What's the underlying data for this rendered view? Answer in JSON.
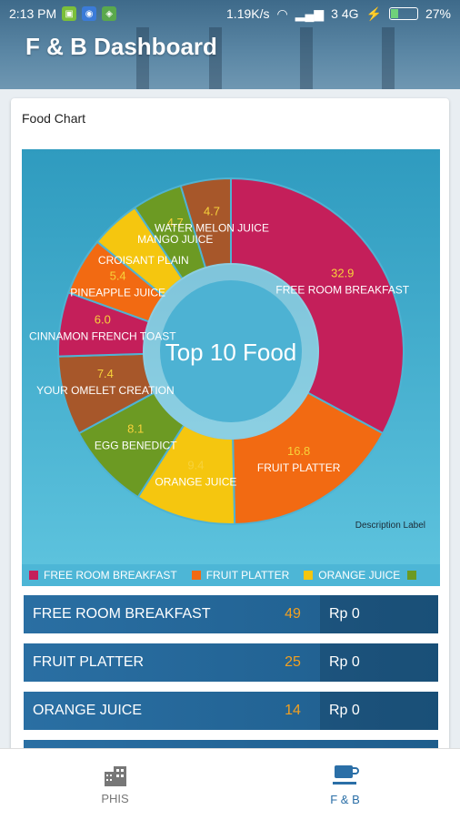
{
  "status": {
    "time": "2:13 PM",
    "speed": "1.19K/s",
    "network": "3 4G",
    "battery": "27%"
  },
  "header": {
    "title": "F & B Dashboard"
  },
  "card": {
    "title": "Food Chart"
  },
  "chart_data": {
    "type": "pie",
    "center_text": "Top 10 Food",
    "description": "Description Label",
    "labels": [
      "FREE ROOM BREAKFAST",
      "FRUIT PLATTER",
      "ORANGE JUICE",
      "EGG BENEDICT",
      "YOUR OMELET CREATION",
      "CINNAMON FRENCH TOAST",
      "PINEAPPLE JUICE",
      "CROISANT PLAIN",
      "MANGO JUICE",
      "WATER MELON JUICE"
    ],
    "values": [
      32.9,
      16.8,
      9.4,
      8.1,
      7.4,
      6.0,
      5.4,
      4.7,
      4.7,
      4.7
    ],
    "value_labels": [
      "32.9",
      "16.8",
      "9.4",
      "8.1",
      "7.4",
      "6.0",
      "5.4",
      "",
      "4.7",
      "4.7"
    ],
    "colors": [
      "#c41f5a",
      "#f26a12",
      "#f5c60f",
      "#6c9a23",
      "#a7572a",
      "#c41f5a",
      "#f26a12",
      "#f5c60f",
      "#6c9a23",
      "#a7572a"
    ],
    "legend_visible": [
      "FREE ROOM BREAKFAST",
      "FRUIT PLATTER",
      "ORANGE JUICE"
    ]
  },
  "rows": [
    {
      "name": "FREE ROOM BREAKFAST",
      "qty": "49",
      "price": "Rp 0"
    },
    {
      "name": "FRUIT PLATTER",
      "qty": "25",
      "price": "Rp 0"
    },
    {
      "name": "ORANGE JUICE",
      "qty": "14",
      "price": "Rp 0"
    }
  ],
  "nav": {
    "phis": "PHIS",
    "fb": "F & B"
  }
}
